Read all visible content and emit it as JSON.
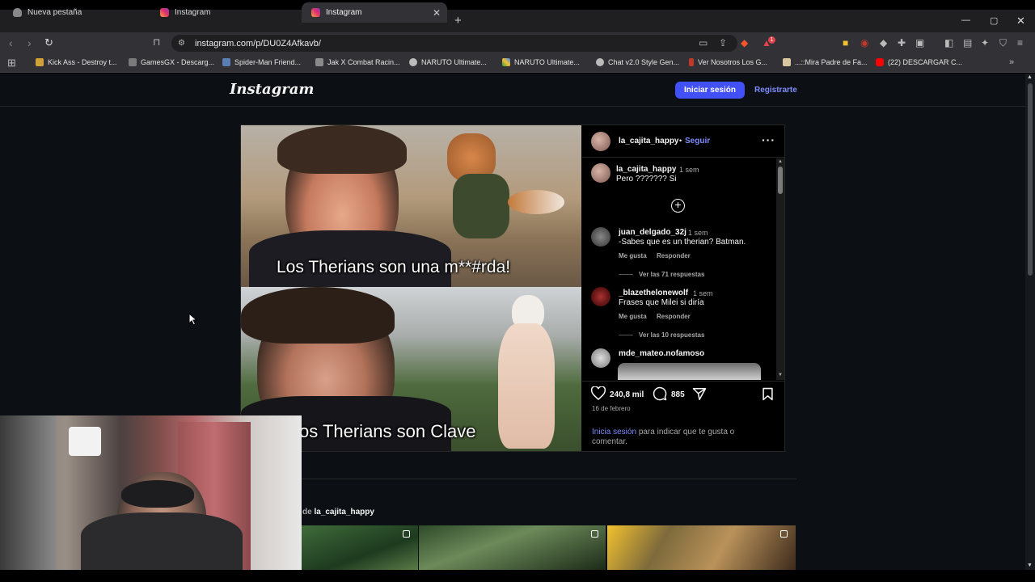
{
  "browser": {
    "tabs": [
      {
        "label": "Nueva pestaña",
        "active": false
      },
      {
        "label": "Instagram",
        "active": false
      },
      {
        "label": "Instagram",
        "active": true
      }
    ],
    "url": "instagram.com/p/DU0Z4Afkavb/",
    "notification_count": "1",
    "bookmarks": [
      "Kick Ass - Destroy t...",
      "GamesGX - Descarg...",
      "Spider-Man Friend...",
      "Jak X Combat Racin...",
      "NARUTO Ultimate...",
      "NARUTO Ultimate...",
      "Chat v2.0 Style Gen...",
      "Ver Nosotros Los G...",
      "...::Mira Padre de Fa...",
      "(22) DESCARGAR C..."
    ]
  },
  "instagram": {
    "logo": "Instagram",
    "login_label": "Iniciar sesión",
    "signup_label": "Registrarte"
  },
  "post": {
    "author": "la_cajita_happy",
    "separator": "•",
    "follow_label": "Seguir",
    "meme_top": "Los Therians son una m**#rda!",
    "meme_bottom": "os Therians son Clave",
    "caption": {
      "user": "la_cajita_happy",
      "time": "1 sem",
      "text": "Pero ??????? Si"
    },
    "comments": [
      {
        "user": "juan_delgado_32j",
        "time": "1 sem",
        "text": "-Sabes que es un therian? Batman.",
        "like": "Me gusta",
        "reply": "Responder",
        "replies": "Ver las 71 respuestas"
      },
      {
        "user": "_blazethelonewolf",
        "time": "1 sem",
        "text": "Frases que Milei si diría",
        "like": "Me gusta",
        "reply": "Responder",
        "replies": "Ver las 10 respuestas"
      },
      {
        "user": "mde_mateo.nofamoso",
        "time": "",
        "text": "",
        "like": "",
        "reply": "",
        "replies": ""
      }
    ],
    "likes": "240,8 mil",
    "comment_count": "885",
    "date": "16 de febrero",
    "login_link": "Inicia sesión",
    "login_text": "para indicar que te gusta o comentar."
  },
  "more": {
    "prefix": "de",
    "user": "la_cajita_happy"
  },
  "colors": {
    "accent": "#4150f7",
    "link": "#7f8cff",
    "background": "#0c1014"
  }
}
